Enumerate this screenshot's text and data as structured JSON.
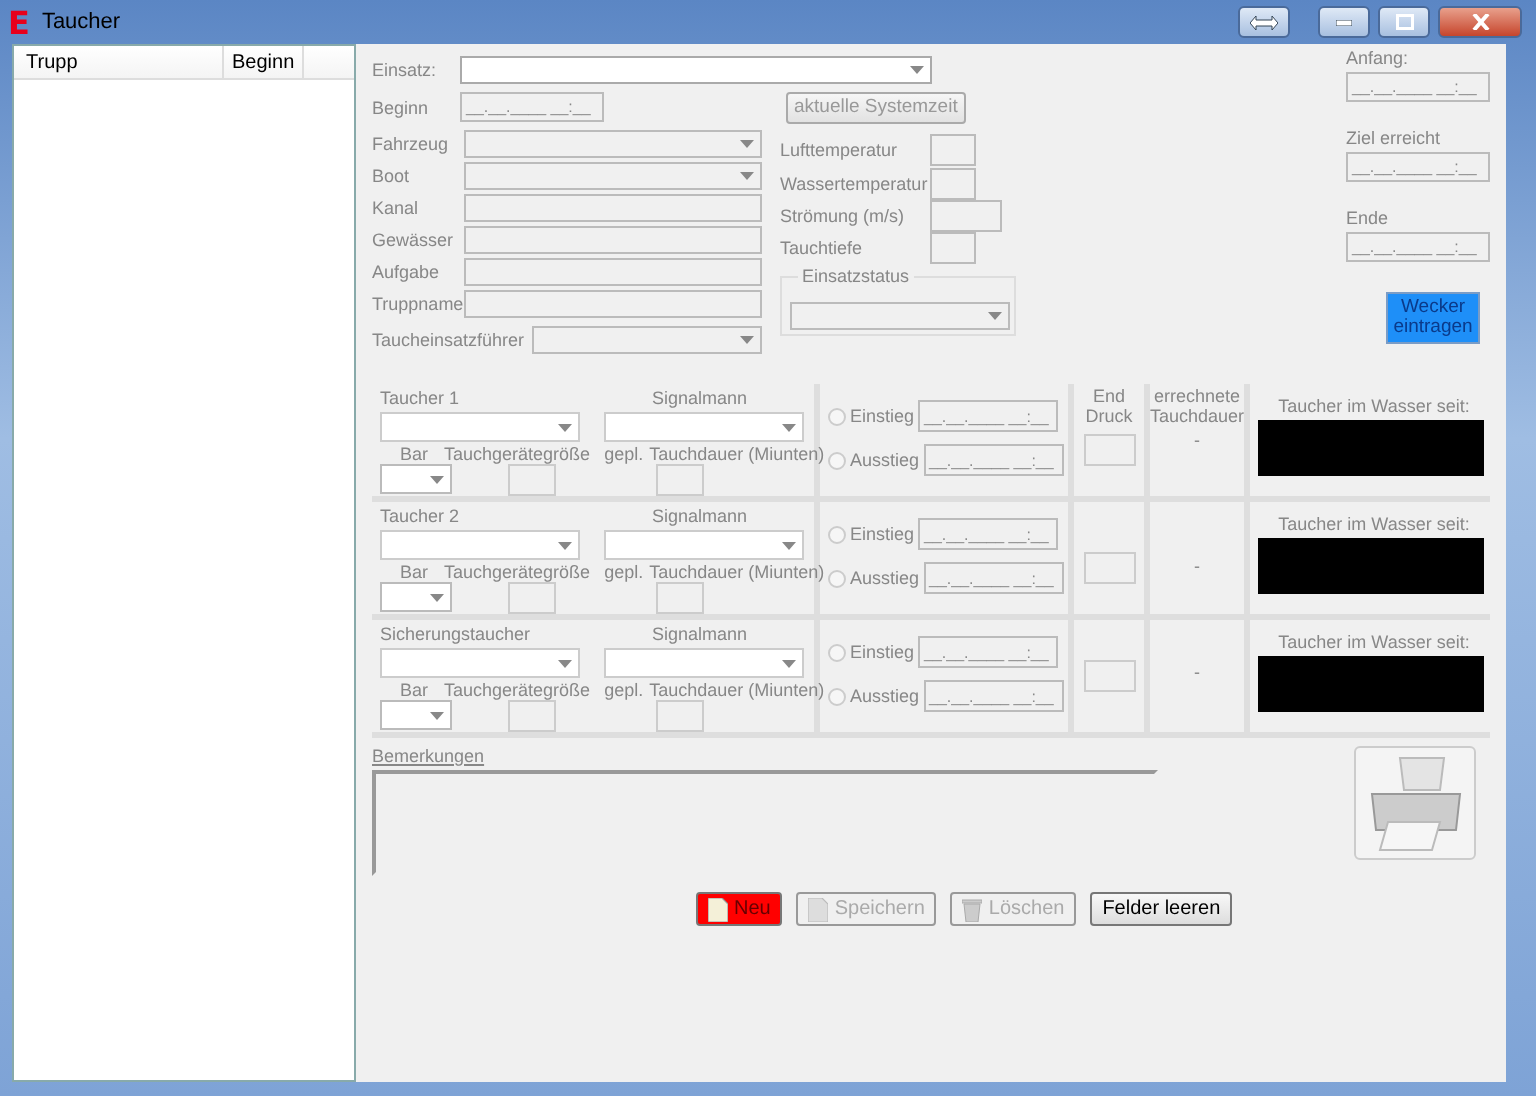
{
  "window": {
    "logo": "E",
    "title": "Taucher"
  },
  "list": {
    "columns": [
      "Trupp",
      "Beginn"
    ]
  },
  "einsatz_fields": [
    {
      "label": "Einsatz:",
      "kind": "combo",
      "disabled": false
    }
  ],
  "beginn": {
    "label": "Beginn",
    "value": "__.__.____ __:__",
    "disabled": true
  },
  "system_time_button": "aktuelle Systemzeit",
  "fields": [
    {
      "label": "Fahrzeug",
      "kind": "combo",
      "disabled": true
    },
    {
      "label": "Boot",
      "kind": "combo",
      "disabled": true
    },
    {
      "label": "Kanal",
      "kind": "text",
      "disabled": true
    },
    {
      "label": "Gewässer",
      "kind": "text",
      "disabled": true
    },
    {
      "label": "Aufgabe",
      "kind": "text",
      "disabled": true
    },
    {
      "label": "Truppname",
      "kind": "text",
      "disabled": true
    },
    {
      "label": "Taucheinsatzführer",
      "kind": "combo",
      "disabled": true
    }
  ],
  "measurements": [
    {
      "label": "Lufttemperatur"
    },
    {
      "label": "Wassertemperatur"
    },
    {
      "label": "Strömung (m/s)"
    },
    {
      "label": "Tauchtiefe"
    }
  ],
  "einsatzstatus": {
    "label": "Einsatzstatus"
  },
  "times": [
    {
      "label": "Anfang:",
      "value": "__.__.____ __:__"
    },
    {
      "label": "Ziel erreicht",
      "value": "__.__.____ __:__"
    },
    {
      "label": "Ende",
      "value": "__.__.____ __:__"
    }
  ],
  "alarm_button": "Wecker eintragen",
  "headers": {
    "end_pressure": "End Druck",
    "duration": "errechnete Tauchdauer"
  },
  "divers": [
    {
      "title": "Taucher 1",
      "signalman_label": "Signalmann",
      "bar_label": "Bar",
      "size_label": "Tauchgerätegröße",
      "planned_label": "gepl.",
      "duration_label": "Tauchdauer (Miunten)",
      "entries": [
        {
          "label": "Einstieg",
          "value": "__.__.____ __:__",
          "selected": false
        },
        {
          "label": "Ausstieg",
          "value": "__.__.____ __:__",
          "selected": false
        }
      ],
      "computed": "-",
      "in_water_label": "Taucher im Wasser seit:"
    },
    {
      "title": "Taucher 2",
      "signalman_label": "Signalmann",
      "bar_label": "Bar",
      "size_label": "Tauchgerätegröße",
      "planned_label": "gepl.",
      "duration_label": "Tauchdauer (Miunten)",
      "entries": [
        {
          "label": "Einstieg",
          "value": "__.__.____ __:__",
          "selected": false
        },
        {
          "label": "Ausstieg",
          "value": "__.__.____ __:__",
          "selected": false
        }
      ],
      "computed": "-",
      "in_water_label": "Taucher im Wasser seit:"
    },
    {
      "title": "Sicherungstaucher",
      "signalman_label": "Signalmann",
      "bar_label": "Bar",
      "size_label": "Tauchgerätegröße",
      "planned_label": "gepl.",
      "duration_label": "Tauchdauer (Miunten)",
      "entries": [
        {
          "label": "Einstieg",
          "value": "__.__.____ __:__",
          "selected": false
        },
        {
          "label": "Ausstieg",
          "value": "__.__.____ __:__",
          "selected": false
        }
      ],
      "computed": "-",
      "in_water_label": "Taucher im Wasser seit:"
    }
  ],
  "remarks": {
    "label": "Bemerkungen"
  },
  "buttons": [
    {
      "label": "Neu",
      "kind": "new",
      "disabled": false
    },
    {
      "label": "Speichern",
      "kind": "save",
      "disabled": true
    },
    {
      "label": "Löschen",
      "kind": "delete",
      "disabled": true
    },
    {
      "label": "Felder leeren",
      "kind": "clear",
      "disabled": false
    }
  ]
}
